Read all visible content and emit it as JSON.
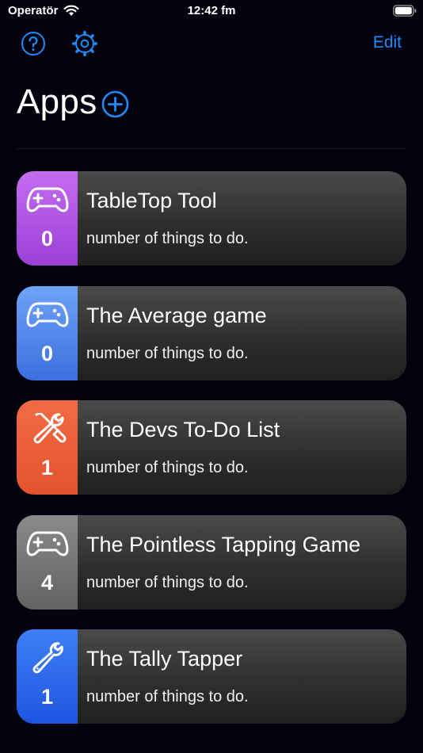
{
  "status_bar": {
    "carrier": "Operatör",
    "time": "12:42 fm"
  },
  "nav": {
    "edit_label": "Edit",
    "accent_color": "#1d8cf8"
  },
  "header": {
    "title": "Apps"
  },
  "apps": [
    {
      "name": "TableTop Tool",
      "subtitle": "number of things to do.",
      "count": "0",
      "icon": "gamecontroller-icon",
      "color_top": "#c46df0",
      "color_bottom": "#9a3fd6"
    },
    {
      "name": "The Average game",
      "subtitle": "number of things to do.",
      "count": "0",
      "icon": "gamecontroller-icon",
      "color_top": "#6fa3f5",
      "color_bottom": "#3c6fe0"
    },
    {
      "name": "The Devs To-Do List",
      "subtitle": "number of things to do.",
      "count": "1",
      "icon": "wrench-screwdriver-icon",
      "color_top": "#f26a44",
      "color_bottom": "#e2532d"
    },
    {
      "name": "The Pointless Tapping Game",
      "subtitle": "number of things to do.",
      "count": "4",
      "icon": "gamecontroller-icon",
      "color_top": "#8a8a8a",
      "color_bottom": "#626262"
    },
    {
      "name": "The Tally Tapper",
      "subtitle": "number of things to do.",
      "count": "1",
      "icon": "wrench-icon",
      "color_top": "#3d7ef5",
      "color_bottom": "#1f55e0"
    }
  ]
}
